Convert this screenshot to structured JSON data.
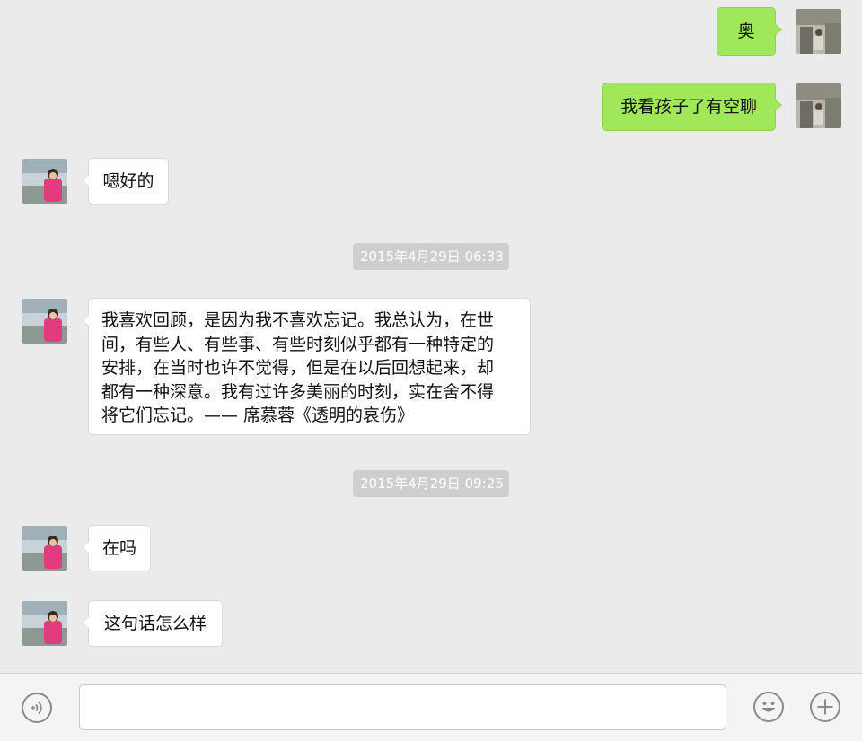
{
  "conversation": {
    "messages": [
      {
        "direction": "out",
        "text": "奥"
      },
      {
        "direction": "out",
        "text": "我看孩子了有空聊"
      },
      {
        "direction": "in",
        "text": "嗯好的"
      },
      {
        "timestamp": "2015年4月29日 06:33"
      },
      {
        "direction": "in",
        "text": "我喜欢回顾，是因为我不喜欢忘记。我总认为，在世\n间，有些人、有些事、有些时刻似乎都有一种特定的\n安排，在当时也许不觉得，但是在以后回想起来，却\n都有一种深意。我有过许多美丽的时刻，实在舍不得\n将它们忘记。—— 席慕蓉《透明的哀伤》"
      },
      {
        "timestamp": "2015年4月29日 09:25"
      },
      {
        "direction": "in",
        "text": "在吗"
      },
      {
        "direction": "in",
        "text": "这句话怎么样"
      }
    ]
  },
  "input_bar": {
    "voice_icon": "voice-icon",
    "emoji_icon": "emoji-icon",
    "plus_icon": "plus-icon",
    "message_value": ""
  },
  "colors": {
    "chat_background": "#ebebeb",
    "outgoing_bubble": "#a0e75a",
    "incoming_bubble": "#ffffff",
    "timestamp_background": "#cecece",
    "input_bar_background": "#f4f4f6"
  }
}
